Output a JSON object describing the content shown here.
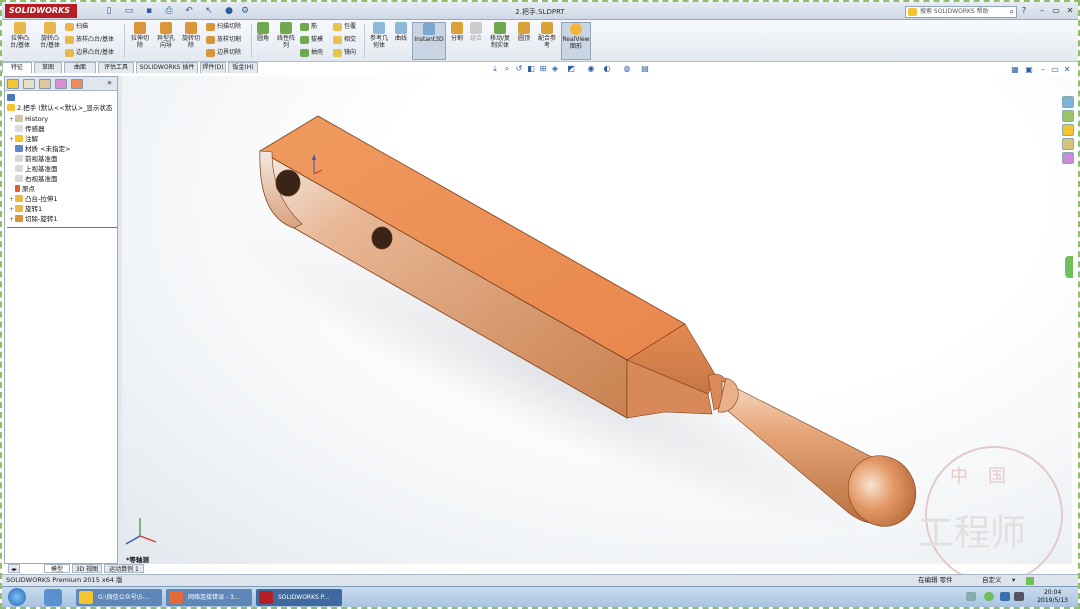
{
  "app": {
    "logo": "SOLIDWORKS",
    "doc_title": "2.把手.SLDPRT",
    "search_placeholder": "搜索 SOLIDWORKS 帮助"
  },
  "ribbon": {
    "extrude_boss": "拉伸凸\n台/基体",
    "revolve_boss": "旋转凸\n台/基体",
    "sweep": "扫描",
    "loft_boss": "放样凸台/基体",
    "boundary_boss": "边界凸台/基体",
    "extrude_cut": "拉伸切\n除",
    "hole_wizard": "异型孔\n向导",
    "revolve_cut": "旋转切\n除",
    "swept_cut": "扫描切除",
    "lofted_cut": "放样切割",
    "boundary_cut": "边界切除",
    "fillet": "圆角",
    "linear_pattern": "线性阵\n列",
    "rib": "筋",
    "draft": "拔模",
    "shell": "抽壳",
    "wrap": "包覆",
    "intersect": "相交",
    "mirror": "镜向",
    "ref_geometry": "参考几\n何体",
    "curves": "曲线",
    "instant3d": "Instant3D",
    "split": "分割",
    "combine": "组合",
    "move_copy": "移动/复\n制实体",
    "dome": "圆顶",
    "mate_ref": "配合参\n考",
    "realview": "RealView\n图形"
  },
  "tabs": [
    "特征",
    "草图",
    "曲面",
    "评估工具",
    "SOLIDWORKS 插件",
    "焊件(D)",
    "钣金(H)"
  ],
  "tree": {
    "root": "2.把手 (默认<<默认>_显示状态",
    "items": [
      "History",
      "传感器",
      "注解",
      "材质 <未指定>",
      "前视基准面",
      "上视基准面",
      "右视基准面",
      "原点",
      "凸台-拉伸1",
      "旋转1",
      "切除-旋转1"
    ]
  },
  "view": {
    "label": "*等轴测"
  },
  "bottom_tabs": [
    "模型",
    "3D 视图",
    "运动算例 1"
  ],
  "status": {
    "left": "SOLIDWORKS Premium 2015 x64 版",
    "mode": "在编辑 零件",
    "units": "自定义"
  },
  "taskbar": {
    "items": [
      "G:\\微信公众号\\5-...",
      "网络连接错误 - 3...",
      "SOLIDWORKS P..."
    ],
    "time": "20:04",
    "date": "2019/5/13"
  },
  "watermark": {
    "top": "中国",
    "bottom": "工程师"
  },
  "colors": {
    "part": "#e8894f",
    "brand": "#b41e24"
  }
}
